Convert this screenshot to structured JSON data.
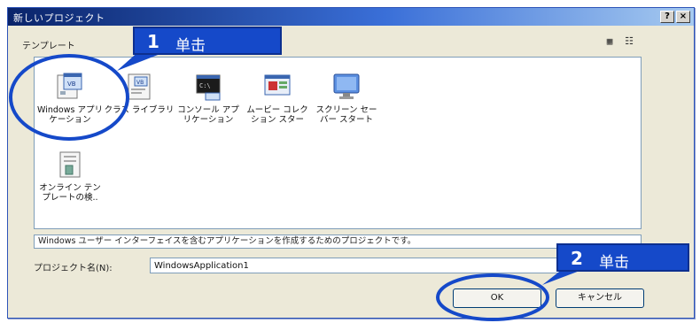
{
  "dialog": {
    "title": "新しいプロジェクト",
    "help_button": "?",
    "close_button": "×",
    "section_label": "テンプレート",
    "view_icons": [
      "large-icons-view",
      "list-view"
    ]
  },
  "templates": [
    {
      "label": "Windows アプリ\nケーション",
      "icon": "windows-application-icon"
    },
    {
      "label": "クラス ライブラリ",
      "icon": "class-library-icon"
    },
    {
      "label": "コンソール アプ\nリケーション",
      "icon": "console-application-icon"
    },
    {
      "label": "ムービー コレク\nション スター",
      "icon": "movie-collection-icon"
    },
    {
      "label": "スクリーン セー\nバー スタート",
      "icon": "screen-saver-icon"
    },
    {
      "label": "オンライン テン\nプレートの検..",
      "icon": "online-template-search-icon"
    }
  ],
  "description": "Windows ユーザー インターフェイスを含むアプリケーションを作成するためのプロジェクトです。",
  "project_name": {
    "label": "プロジェクト名(N):",
    "value": "WindowsApplication1"
  },
  "buttons": {
    "ok": "OK",
    "cancel": "キャンセル"
  },
  "callouts": [
    {
      "number": "1",
      "text": "单击"
    },
    {
      "number": "2",
      "text": "单击"
    }
  ],
  "colors": {
    "callout": "#1549c9",
    "circle": "#1549c9",
    "titlebar": "#0a246a"
  }
}
